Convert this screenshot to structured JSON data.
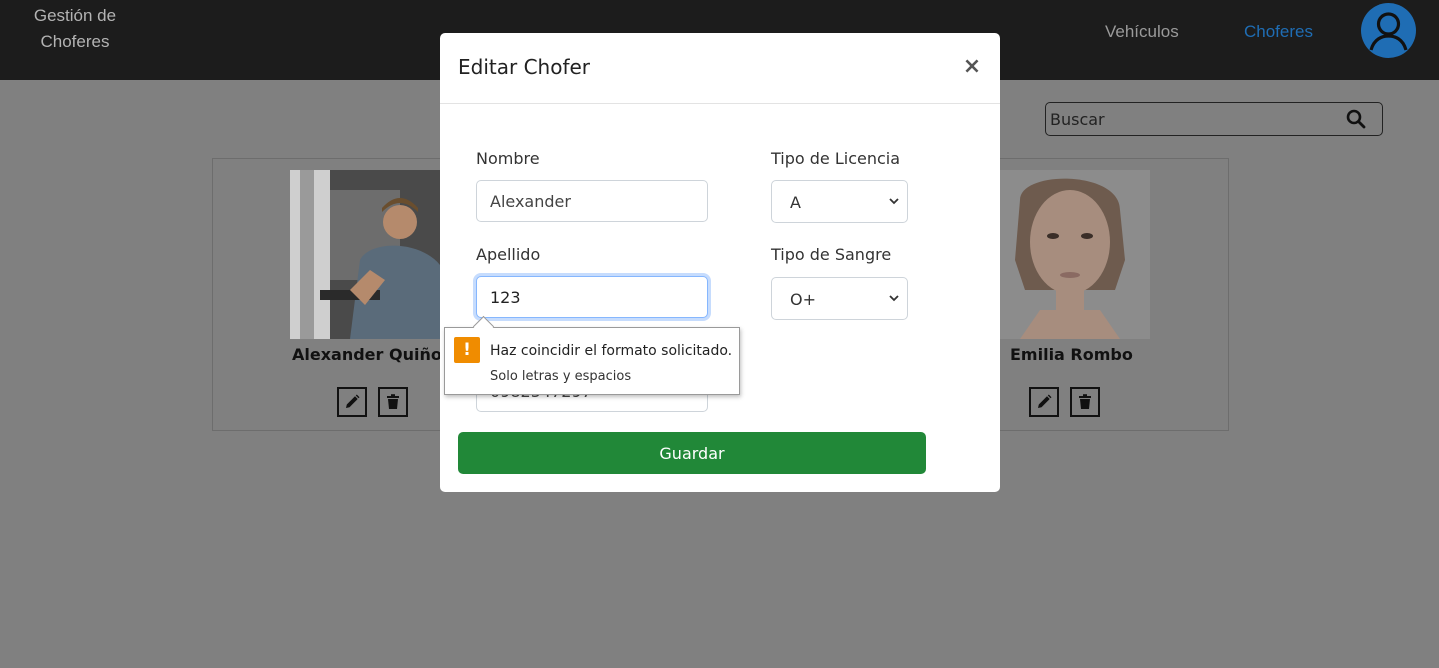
{
  "nav": {
    "brand": "Gestión de Choferes",
    "links": [
      "Vehículos",
      "Choferes"
    ],
    "active_link": "Choferes",
    "accent_color": "#1f6db4"
  },
  "search": {
    "placeholder": "Buscar",
    "icon": "search-icon"
  },
  "drivers": [
    {
      "name": "Alexander Quiñon"
    },
    {
      "name": "Emilia Rombo"
    }
  ],
  "modal": {
    "title": "Editar Chofer",
    "close": "×",
    "fields": {
      "nombre": {
        "label": "Nombre",
        "value": "Alexander"
      },
      "apellido": {
        "label": "Apellido",
        "value": "123"
      },
      "telefono": {
        "value": "0982547297"
      },
      "licencia": {
        "label": "Tipo de Licencia",
        "value": "A"
      },
      "sangre": {
        "label": "Tipo de Sangre",
        "value": "O+"
      }
    },
    "save_label": "Guardar",
    "save_color": "#218838"
  },
  "validation": {
    "message": "Haz coincidir el formato solicitado.",
    "hint": "Solo letras y espacios",
    "icon_glyph": "!",
    "icon_color": "#f08c00"
  }
}
